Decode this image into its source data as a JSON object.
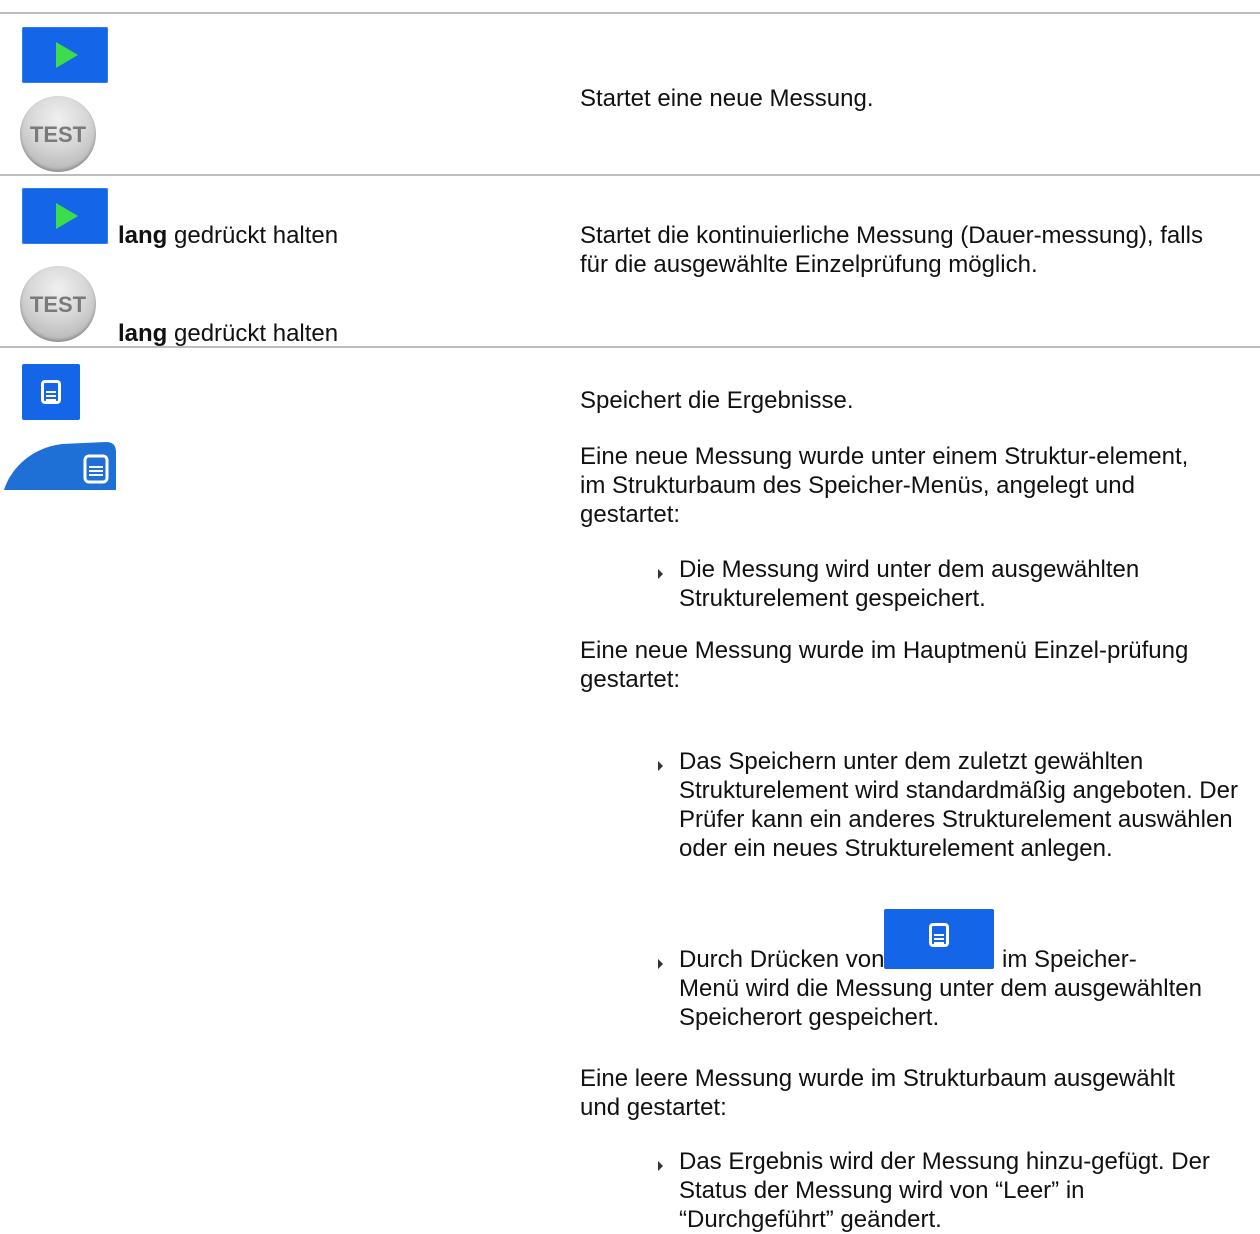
{
  "rows": [
    {
      "description": "Startet eine neue Messung."
    },
    {
      "label_bold_1": "lang",
      "label_rest_1": " gedrückt halten",
      "label_bold_2": "lang",
      "label_rest_2": " gedrückt halten",
      "description": "Startet die kontinuierliche Messung (Dauer-messung), falls für die ausgewählte Einzelprüfung möglich."
    },
    {
      "p1": "Speichert die Ergebnisse.",
      "p2": "Eine neue Messung wurde unter einem Struktur-element, im Strukturbaum des Speicher-Menüs, angelegt und gestartet:",
      "b1": "Die Messung wird unter dem ausgewählten Strukturelement gespeichert.",
      "p3": "Eine neue Messung wurde im Hauptmenü Einzel-prüfung gestartet:",
      "b2": "Das Speichern unter dem zuletzt gewählten Strukturelement wird standardmäßig angeboten. Der Prüfer kann ein anderes Strukturelement auswählen oder ein neues Strukturelement anlegen.",
      "b3_before": "Durch Drücken von",
      "b3_after": "im Speicher-",
      "b3_rest": "Menü wird die Messung unter dem ausgewählten Speicherort gespeichert.",
      "p4": "Eine leere Messung wurde im Strukturbaum ausgewählt und gestartet:",
      "b4": "Das Ergebnis wird der Messung hinzu-gefügt. Der Status der Messung wird von “Leer” in “Durchgeführt” geändert."
    }
  ],
  "test_button_label": "TEST",
  "icons": [
    "play-icon",
    "test-button-icon",
    "save-icon",
    "save-tab-icon"
  ],
  "colors": {
    "button_blue": "#1565e8",
    "play_green": "#3ddc4a",
    "rule_gray": "#bdbdbd"
  }
}
